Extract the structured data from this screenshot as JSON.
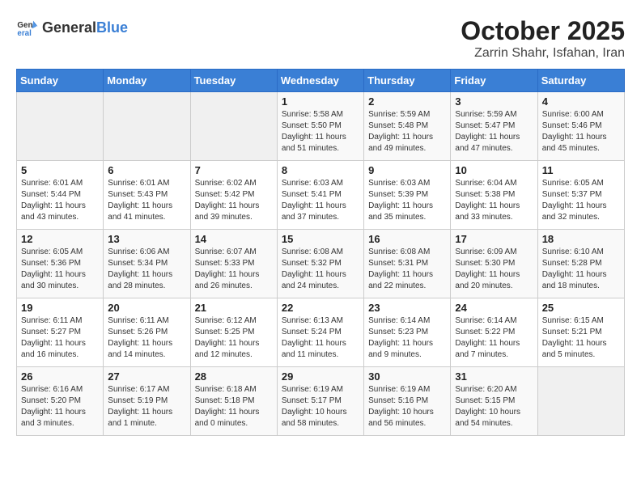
{
  "header": {
    "logo_general": "General",
    "logo_blue": "Blue",
    "month_title": "October 2025",
    "location": "Zarrin Shahr, Isfahan, Iran"
  },
  "days_of_week": [
    "Sunday",
    "Monday",
    "Tuesday",
    "Wednesday",
    "Thursday",
    "Friday",
    "Saturday"
  ],
  "weeks": [
    [
      {
        "day": "",
        "info": ""
      },
      {
        "day": "",
        "info": ""
      },
      {
        "day": "",
        "info": ""
      },
      {
        "day": "1",
        "info": "Sunrise: 5:58 AM\nSunset: 5:50 PM\nDaylight: 11 hours\nand 51 minutes."
      },
      {
        "day": "2",
        "info": "Sunrise: 5:59 AM\nSunset: 5:48 PM\nDaylight: 11 hours\nand 49 minutes."
      },
      {
        "day": "3",
        "info": "Sunrise: 5:59 AM\nSunset: 5:47 PM\nDaylight: 11 hours\nand 47 minutes."
      },
      {
        "day": "4",
        "info": "Sunrise: 6:00 AM\nSunset: 5:46 PM\nDaylight: 11 hours\nand 45 minutes."
      }
    ],
    [
      {
        "day": "5",
        "info": "Sunrise: 6:01 AM\nSunset: 5:44 PM\nDaylight: 11 hours\nand 43 minutes."
      },
      {
        "day": "6",
        "info": "Sunrise: 6:01 AM\nSunset: 5:43 PM\nDaylight: 11 hours\nand 41 minutes."
      },
      {
        "day": "7",
        "info": "Sunrise: 6:02 AM\nSunset: 5:42 PM\nDaylight: 11 hours\nand 39 minutes."
      },
      {
        "day": "8",
        "info": "Sunrise: 6:03 AM\nSunset: 5:41 PM\nDaylight: 11 hours\nand 37 minutes."
      },
      {
        "day": "9",
        "info": "Sunrise: 6:03 AM\nSunset: 5:39 PM\nDaylight: 11 hours\nand 35 minutes."
      },
      {
        "day": "10",
        "info": "Sunrise: 6:04 AM\nSunset: 5:38 PM\nDaylight: 11 hours\nand 33 minutes."
      },
      {
        "day": "11",
        "info": "Sunrise: 6:05 AM\nSunset: 5:37 PM\nDaylight: 11 hours\nand 32 minutes."
      }
    ],
    [
      {
        "day": "12",
        "info": "Sunrise: 6:05 AM\nSunset: 5:36 PM\nDaylight: 11 hours\nand 30 minutes."
      },
      {
        "day": "13",
        "info": "Sunrise: 6:06 AM\nSunset: 5:34 PM\nDaylight: 11 hours\nand 28 minutes."
      },
      {
        "day": "14",
        "info": "Sunrise: 6:07 AM\nSunset: 5:33 PM\nDaylight: 11 hours\nand 26 minutes."
      },
      {
        "day": "15",
        "info": "Sunrise: 6:08 AM\nSunset: 5:32 PM\nDaylight: 11 hours\nand 24 minutes."
      },
      {
        "day": "16",
        "info": "Sunrise: 6:08 AM\nSunset: 5:31 PM\nDaylight: 11 hours\nand 22 minutes."
      },
      {
        "day": "17",
        "info": "Sunrise: 6:09 AM\nSunset: 5:30 PM\nDaylight: 11 hours\nand 20 minutes."
      },
      {
        "day": "18",
        "info": "Sunrise: 6:10 AM\nSunset: 5:28 PM\nDaylight: 11 hours\nand 18 minutes."
      }
    ],
    [
      {
        "day": "19",
        "info": "Sunrise: 6:11 AM\nSunset: 5:27 PM\nDaylight: 11 hours\nand 16 minutes."
      },
      {
        "day": "20",
        "info": "Sunrise: 6:11 AM\nSunset: 5:26 PM\nDaylight: 11 hours\nand 14 minutes."
      },
      {
        "day": "21",
        "info": "Sunrise: 6:12 AM\nSunset: 5:25 PM\nDaylight: 11 hours\nand 12 minutes."
      },
      {
        "day": "22",
        "info": "Sunrise: 6:13 AM\nSunset: 5:24 PM\nDaylight: 11 hours\nand 11 minutes."
      },
      {
        "day": "23",
        "info": "Sunrise: 6:14 AM\nSunset: 5:23 PM\nDaylight: 11 hours\nand 9 minutes."
      },
      {
        "day": "24",
        "info": "Sunrise: 6:14 AM\nSunset: 5:22 PM\nDaylight: 11 hours\nand 7 minutes."
      },
      {
        "day": "25",
        "info": "Sunrise: 6:15 AM\nSunset: 5:21 PM\nDaylight: 11 hours\nand 5 minutes."
      }
    ],
    [
      {
        "day": "26",
        "info": "Sunrise: 6:16 AM\nSunset: 5:20 PM\nDaylight: 11 hours\nand 3 minutes."
      },
      {
        "day": "27",
        "info": "Sunrise: 6:17 AM\nSunset: 5:19 PM\nDaylight: 11 hours\nand 1 minute."
      },
      {
        "day": "28",
        "info": "Sunrise: 6:18 AM\nSunset: 5:18 PM\nDaylight: 11 hours\nand 0 minutes."
      },
      {
        "day": "29",
        "info": "Sunrise: 6:19 AM\nSunset: 5:17 PM\nDaylight: 10 hours\nand 58 minutes."
      },
      {
        "day": "30",
        "info": "Sunrise: 6:19 AM\nSunset: 5:16 PM\nDaylight: 10 hours\nand 56 minutes."
      },
      {
        "day": "31",
        "info": "Sunrise: 6:20 AM\nSunset: 5:15 PM\nDaylight: 10 hours\nand 54 minutes."
      },
      {
        "day": "",
        "info": ""
      }
    ]
  ]
}
